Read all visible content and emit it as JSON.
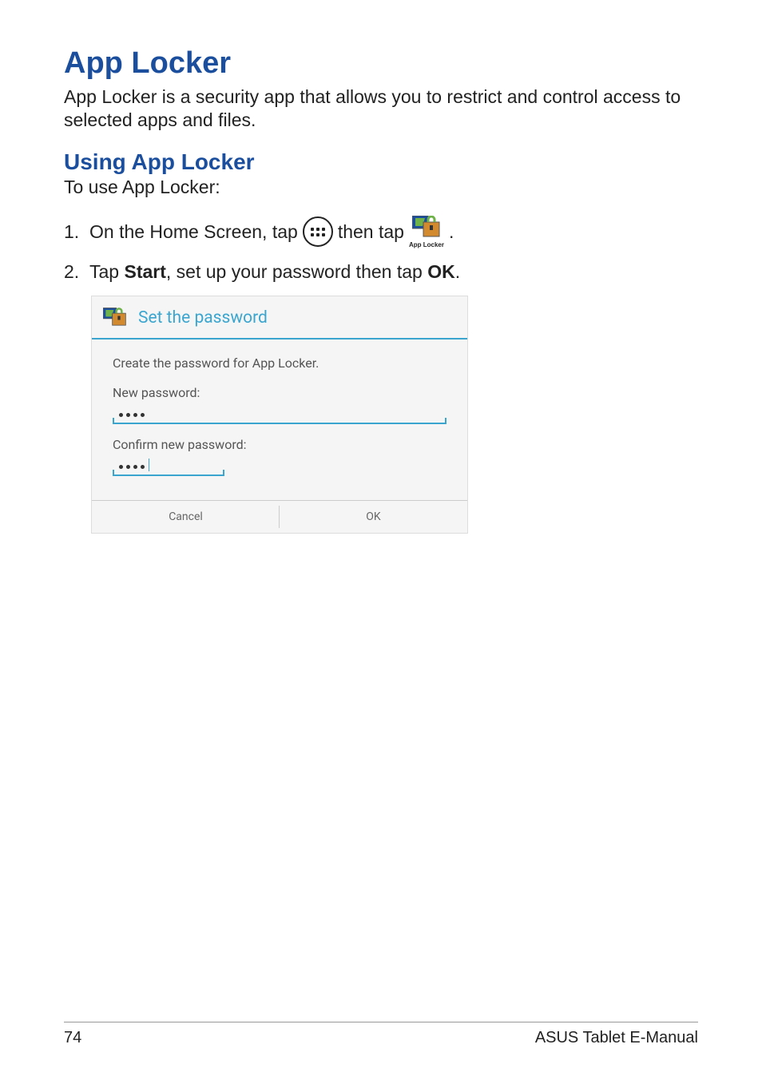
{
  "heading": "App Locker",
  "intro": "App Locker is a security app that allows you to restrict and control access to selected apps and files.",
  "subheading": "Using App Locker",
  "lead": "To use App Locker:",
  "steps": {
    "one": {
      "num": "1.",
      "part1": "On the Home Screen, tap",
      "part2": "then tap",
      "end": ".",
      "launcher_caption": "App Locker"
    },
    "two": {
      "num": "2.",
      "pre": "Tap ",
      "bold1": "Start",
      "mid": ", set up your password then tap ",
      "bold2": "OK",
      "end": "."
    }
  },
  "dialog": {
    "title": "Set the password",
    "instruction": "Create the password for App Locker.",
    "new_label": "New password:",
    "confirm_label": "Confirm new password:",
    "cancel": "Cancel",
    "ok": "OK"
  },
  "footer": {
    "page": "74",
    "manual": "ASUS Tablet E-Manual"
  }
}
